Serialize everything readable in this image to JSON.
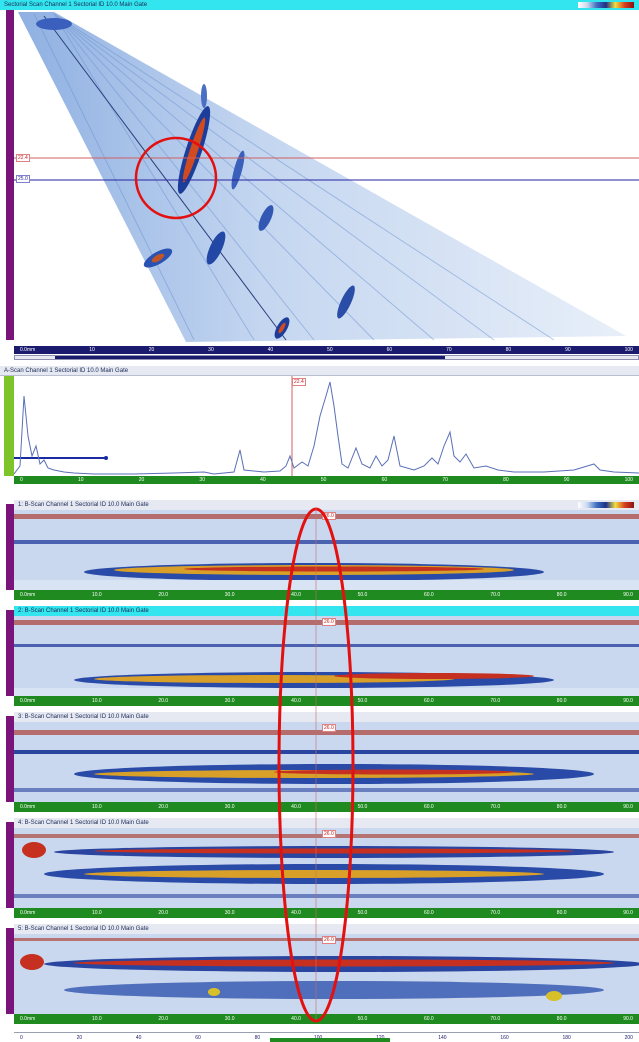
{
  "sector_scan": {
    "title": "Sectorial Scan Channel 1 Sectorial  ID 10.0 Main Gate",
    "tick_labels": [
      "0.0mm",
      "10",
      "20",
      "30",
      "40",
      "50",
      "60",
      "70",
      "80",
      "90",
      "100"
    ],
    "cursor_labels": [
      "22.4",
      "25.0"
    ]
  },
  "ascan": {
    "title": "A-Scan Channel 1 Sectorial  ID 10.0 Main Gate",
    "tick_labels": [
      "0",
      "10",
      "20",
      "30",
      "40",
      "50",
      "60",
      "70",
      "80",
      "90",
      "100"
    ],
    "cursor_label": "22.4"
  },
  "strips": [
    {
      "title": "1: B-Scan Channel 1 Sectorial  ID 10.0 Main Gate",
      "cursor_label": "26.0",
      "tick_labels": [
        "0.0mm",
        "10.0",
        "20.0",
        "30.0",
        "40.0",
        "50.0",
        "60.0",
        "70.0",
        "80.0",
        "90.0"
      ]
    },
    {
      "title": "2: B-Scan Channel 1 Sectorial  ID 10.0 Main Gate",
      "cursor_label": "26.0",
      "tick_labels": [
        "0.0mm",
        "10.0",
        "20.0",
        "30.0",
        "40.0",
        "50.0",
        "60.0",
        "70.0",
        "80.0",
        "90.0"
      ]
    },
    {
      "title": "3: B-Scan Channel 1 Sectorial  ID 10.0 Main Gate",
      "cursor_label": "26.0",
      "tick_labels": [
        "0.0mm",
        "10.0",
        "20.0",
        "30.0",
        "40.0",
        "50.0",
        "60.0",
        "70.0",
        "80.0",
        "90.0"
      ]
    },
    {
      "title": "4: B-Scan Channel 1 Sectorial  ID 10.0 Main Gate",
      "cursor_label": "26.0",
      "tick_labels": [
        "0.0mm",
        "10.0",
        "20.0",
        "30.0",
        "40.0",
        "50.0",
        "60.0",
        "70.0",
        "80.0",
        "90.0"
      ]
    },
    {
      "title": "5: B-Scan Channel 1 Sectorial  ID 10.0 Main Gate",
      "cursor_label": "26.0",
      "tick_labels": [
        "0.0mm",
        "10.0",
        "20.0",
        "30.0",
        "40.0",
        "50.0",
        "60.0",
        "70.0",
        "80.0",
        "90.0"
      ]
    }
  ],
  "bottom_ruler": {
    "tick_labels": [
      "0",
      "20",
      "40",
      "60",
      "80",
      "100",
      "120",
      "140",
      "160",
      "180",
      "200"
    ]
  },
  "colors": {
    "ruler_purple": "#7a147a",
    "navy": "#1a1a6e",
    "green": "#1f8a1f",
    "cyan": "#33e5ee",
    "highlight_red": "#e31010",
    "cursor_blue": "#2525a0"
  }
}
